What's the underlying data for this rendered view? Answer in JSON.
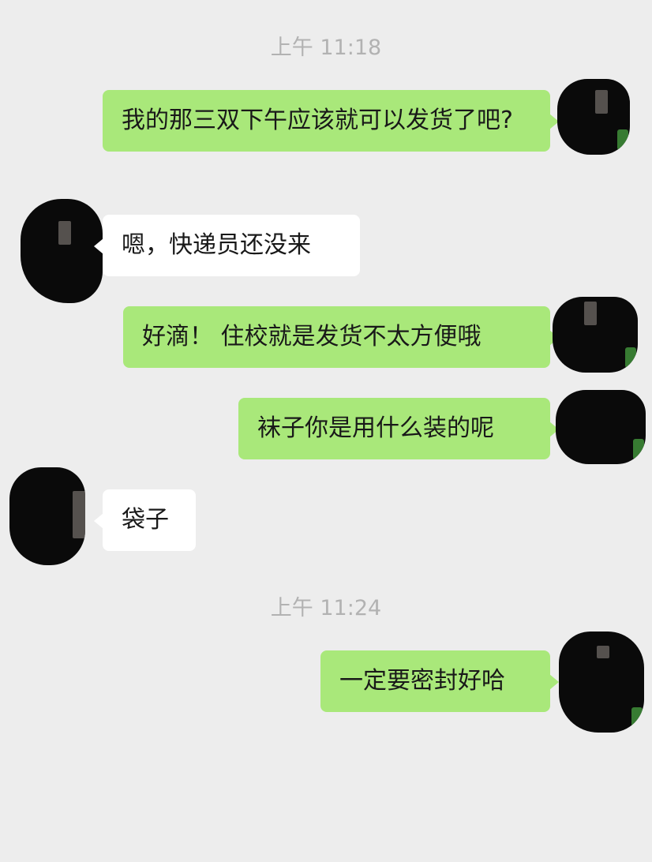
{
  "chat": {
    "timestamps": [
      "上午 11:18",
      "上午 11:24"
    ],
    "messages": [
      {
        "sender": "me",
        "text": "我的那三双下午应该就可以发货了吧?"
      },
      {
        "sender": "them",
        "text": "嗯，快递员还没来"
      },
      {
        "sender": "me",
        "text": "好滴！ 住校就是发货不太方便哦"
      },
      {
        "sender": "me",
        "text": "袜子你是用什么装的呢"
      },
      {
        "sender": "them",
        "text": "袋子"
      },
      {
        "sender": "me",
        "text": "一定要密封好哈"
      }
    ]
  },
  "colors": {
    "background": "#ededed",
    "outgoing_bubble": "#a9e87a",
    "incoming_bubble": "#ffffff",
    "timestamp_text": "#b2b2b2",
    "message_text": "#191919"
  },
  "icons": {
    "avatar": "user-avatar-redacted"
  }
}
